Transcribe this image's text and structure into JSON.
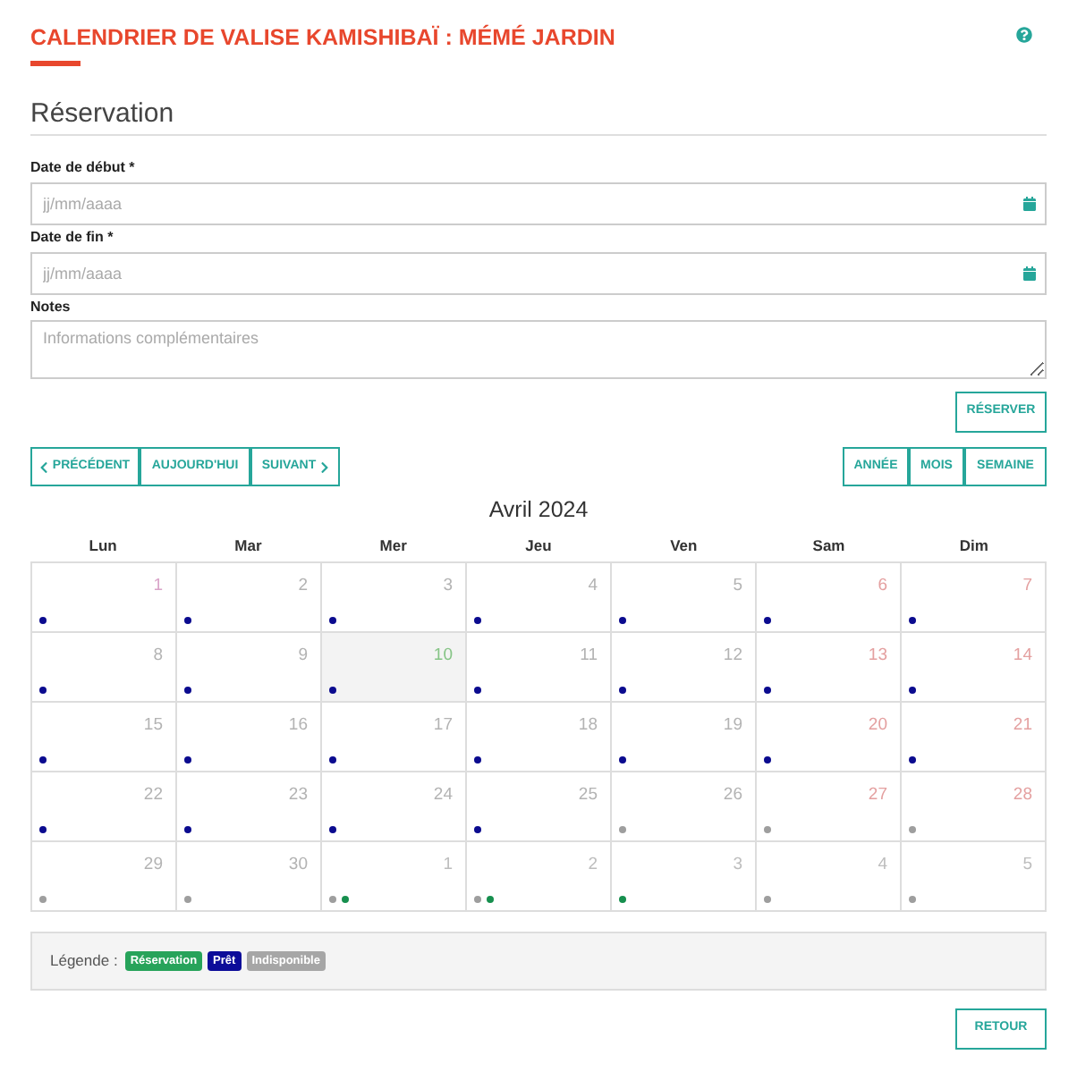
{
  "title": "CALENDRIER DE VALISE KAMISHIBAÏ : MÉMÉ JARDIN",
  "section_title": "Réservation",
  "form": {
    "fields": [
      {
        "kind": "date",
        "label": "Date de début *",
        "placeholder": "jj/mm/aaaa"
      },
      {
        "kind": "date",
        "label": "Date de fin *",
        "placeholder": "jj/mm/aaaa"
      },
      {
        "kind": "textarea",
        "label": "Notes",
        "placeholder": "Informations complémentaires"
      }
    ],
    "submit": "RÉSERVER"
  },
  "navigation": [
    {
      "label": "PRÉCÉDENT",
      "kind": "previous"
    },
    {
      "label": "AUJOURD'HUI",
      "kind": "today"
    },
    {
      "label": "SUIVANT",
      "kind": "next"
    }
  ],
  "views": [
    {
      "label": "ANNÉE"
    },
    {
      "label": "MOIS"
    },
    {
      "label": "SEMAINE"
    }
  ],
  "calendar": {
    "month_title": "Avril 2024",
    "weekdays": [
      "Lun",
      "Mar",
      "Mer",
      "Jeu",
      "Ven",
      "Sam",
      "Dim"
    ],
    "weeks": [
      {
        "days": [
          {
            "number": "1",
            "kind": "holiday",
            "dots": [
              {
                "color": "#0b0b8f"
              }
            ]
          },
          {
            "number": "2",
            "kind": "weekday",
            "dots": [
              {
                "color": "#0b0b8f"
              }
            ]
          },
          {
            "number": "3",
            "kind": "weekday",
            "dots": [
              {
                "color": "#0b0b8f"
              }
            ]
          },
          {
            "number": "4",
            "kind": "weekday",
            "dots": [
              {
                "color": "#0b0b8f"
              }
            ]
          },
          {
            "number": "5",
            "kind": "weekday",
            "dots": [
              {
                "color": "#0b0b8f"
              }
            ]
          },
          {
            "number": "6",
            "kind": "weekend",
            "dots": [
              {
                "color": "#0b0b8f"
              }
            ]
          },
          {
            "number": "7",
            "kind": "weekend",
            "dots": [
              {
                "color": "#0b0b8f"
              }
            ]
          }
        ]
      },
      {
        "days": [
          {
            "number": "8",
            "kind": "weekday",
            "dots": [
              {
                "color": "#0b0b8f"
              }
            ]
          },
          {
            "number": "9",
            "kind": "weekday",
            "dots": [
              {
                "color": "#0b0b8f"
              }
            ]
          },
          {
            "number": "10",
            "kind": "today",
            "dots": [
              {
                "color": "#0b0b8f"
              }
            ]
          },
          {
            "number": "11",
            "kind": "weekday",
            "dots": [
              {
                "color": "#0b0b8f"
              }
            ]
          },
          {
            "number": "12",
            "kind": "weekday",
            "dots": [
              {
                "color": "#0b0b8f"
              }
            ]
          },
          {
            "number": "13",
            "kind": "weekend",
            "dots": [
              {
                "color": "#0b0b8f"
              }
            ]
          },
          {
            "number": "14",
            "kind": "weekend",
            "dots": [
              {
                "color": "#0b0b8f"
              }
            ]
          }
        ]
      },
      {
        "days": [
          {
            "number": "15",
            "kind": "weekday",
            "dots": [
              {
                "color": "#0b0b8f"
              }
            ]
          },
          {
            "number": "16",
            "kind": "weekday",
            "dots": [
              {
                "color": "#0b0b8f"
              }
            ]
          },
          {
            "number": "17",
            "kind": "weekday",
            "dots": [
              {
                "color": "#0b0b8f"
              }
            ]
          },
          {
            "number": "18",
            "kind": "weekday",
            "dots": [
              {
                "color": "#0b0b8f"
              }
            ]
          },
          {
            "number": "19",
            "kind": "weekday",
            "dots": [
              {
                "color": "#0b0b8f"
              }
            ]
          },
          {
            "number": "20",
            "kind": "weekend",
            "dots": [
              {
                "color": "#0b0b8f"
              }
            ]
          },
          {
            "number": "21",
            "kind": "weekend",
            "dots": [
              {
                "color": "#0b0b8f"
              }
            ]
          }
        ]
      },
      {
        "days": [
          {
            "number": "22",
            "kind": "weekday",
            "dots": [
              {
                "color": "#0b0b8f"
              }
            ]
          },
          {
            "number": "23",
            "kind": "weekday",
            "dots": [
              {
                "color": "#0b0b8f"
              }
            ]
          },
          {
            "number": "24",
            "kind": "weekday",
            "dots": [
              {
                "color": "#0b0b8f"
              }
            ]
          },
          {
            "number": "25",
            "kind": "weekday",
            "dots": [
              {
                "color": "#0b0b8f"
              }
            ]
          },
          {
            "number": "26",
            "kind": "weekday",
            "dots": [
              {
                "color": "#9e9e9e"
              }
            ]
          },
          {
            "number": "27",
            "kind": "weekend",
            "dots": [
              {
                "color": "#9e9e9e"
              }
            ]
          },
          {
            "number": "28",
            "kind": "weekend",
            "dots": [
              {
                "color": "#9e9e9e"
              }
            ]
          }
        ]
      },
      {
        "days": [
          {
            "number": "29",
            "kind": "weekday",
            "dots": [
              {
                "color": "#9e9e9e"
              }
            ]
          },
          {
            "number": "30",
            "kind": "weekday",
            "dots": [
              {
                "color": "#9e9e9e"
              }
            ]
          },
          {
            "number": "1",
            "kind": "outside",
            "dots": [
              {
                "color": "#9e9e9e"
              },
              {
                "color": "#168f4e"
              }
            ]
          },
          {
            "number": "2",
            "kind": "outside",
            "dots": [
              {
                "color": "#9e9e9e"
              },
              {
                "color": "#168f4e"
              }
            ]
          },
          {
            "number": "3",
            "kind": "outside",
            "dots": [
              {
                "color": "#168f4e"
              }
            ]
          },
          {
            "number": "4",
            "kind": "outside",
            "dots": [
              {
                "color": "#9e9e9e"
              }
            ]
          },
          {
            "number": "5",
            "kind": "outside",
            "dots": [
              {
                "color": "#9e9e9e"
              }
            ]
          }
        ]
      }
    ]
  },
  "legend": {
    "label": "Légende :",
    "items": [
      {
        "label": "Réservation",
        "color": "#27a35a"
      },
      {
        "label": "Prêt",
        "color": "#0c0c99"
      },
      {
        "label": "Indisponible",
        "color": "#a6a6a6"
      }
    ]
  },
  "back_button": "RETOUR"
}
